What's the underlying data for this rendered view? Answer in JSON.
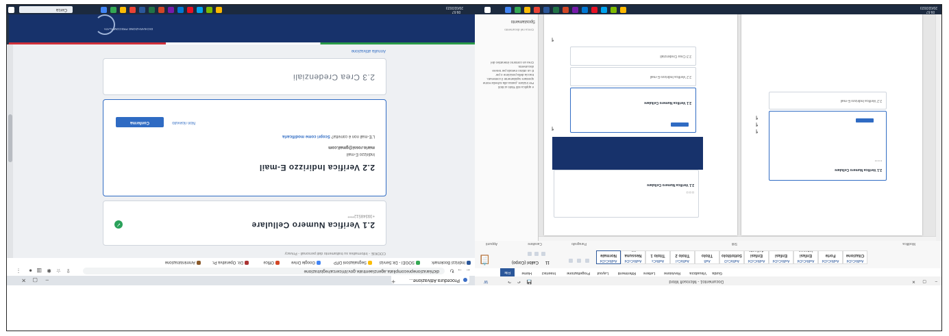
{
  "browser": {
    "tab_title": "Procedura Attivazione...",
    "address": "dichiarazioneprecompilata.agenziaentrate.gov.it/ricerca/registrazione",
    "bookmarks": [
      "Indirizzi Bookmark",
      "SOGEI - Dir.Servizi",
      "Segnalazioni DFP",
      "Google Drive",
      "Office",
      "Dir. Operativa Pr.",
      "Amministrazione"
    ],
    "notice": "COOKIE - Informativa su trattamento dati personali - Privacy",
    "page": {
      "top_link": "Annulla attivazione",
      "step_23": {
        "title": "2.3 Crea Credenziali"
      },
      "step_22": {
        "title": "2.2 Verifica Indirizzo E-mail",
        "label": "Indirizzo E-mail",
        "email": "mario.rossi@gmail.com",
        "hint": "L'E-mail non è corretta?",
        "hint_link": "Scopri come modificarla",
        "confirm_button": "Conferma",
        "secondary_button": "Non ricevuto"
      },
      "step_21": {
        "title": "2.1 Verifica Numero Cellulare",
        "number": "+39348512****"
      },
      "banner_text": "DICHIARAZIONE PRECOMPILATA"
    }
  },
  "taskbar": {
    "search_placeholder": "Cerca",
    "left_clock": {
      "time": "09:57",
      "date": "20/02/2023"
    },
    "right_clock": {
      "time": "09:57",
      "date": "20/02/2023"
    },
    "colors": [
      "#4285f4",
      "#34a853",
      "#fbbc05",
      "#ea4335",
      "#2b579a",
      "#217346",
      "#d24726",
      "#7719aa",
      "#0078d4"
    ]
  },
  "word": {
    "title": "Documento1 - Microsoft Word",
    "status": {
      "page": "Pagina: 1 di 2",
      "words": "Parole: 12"
    },
    "tabs": [
      "File",
      "Home",
      "Inserisci",
      "Progettazione",
      "Layout",
      "Riferimenti",
      "Lettere",
      "Revisione",
      "Visualizza",
      "Guida"
    ],
    "ribbon": {
      "font": "Calibri (Corpo)",
      "size": "11",
      "groups": [
        "Appunti",
        "Carattere",
        "Paragrafo",
        "Stili",
        "Modifica"
      ],
      "styles": [
        {
          "sample": "AaBbCcDd",
          "name": "Normale"
        },
        {
          "sample": "AaBbCcDd",
          "name": "Nessuna sp."
        },
        {
          "sample": "AaBbCc",
          "name": "Titolo 1"
        },
        {
          "sample": "AaBbCcI",
          "name": "Titolo 2"
        },
        {
          "sample": "AaB",
          "name": "Titolo"
        },
        {
          "sample": "AaBbCcD",
          "name": "Sottotitolo"
        },
        {
          "sample": "AaBbCcDd",
          "name": "Enfasi delicata"
        },
        {
          "sample": "AaBbCcDd",
          "name": "Enfasi"
        },
        {
          "sample": "AaBbCcDd",
          "name": "Enfasi intensa"
        },
        {
          "sample": "AaBbCcDd",
          "name": "Forte"
        },
        {
          "sample": "AaBbCcDd",
          "name": "Citazione"
        }
      ]
    },
    "nav_pane": {
      "title": "Spostamento",
      "search": "Cerca nel documento",
      "lines": [
        "Crea un contorno interattivo del",
        "documento.",
        "È un ottimo metodo per tenere",
        "traccia della posizione o per",
        "spostare rapidamente il contenuto.",
        "Per iniziare, passa alla scheda Home",
        "e applica stili Titolo ai titoli"
      ]
    },
    "doc_cards": {
      "c1": "2.3 Crea Credenziali",
      "c2": "2.2 Verifica Indirizzo E-mail",
      "c3": "2.1 Verifica Numero Cellulare",
      "c4": "2.1 Verifica Numero Cellulare",
      "c5": "2.2 Verifica Indirizzo E-mail",
      "c6": "2.1 Verifica Numero Cellulare"
    }
  }
}
